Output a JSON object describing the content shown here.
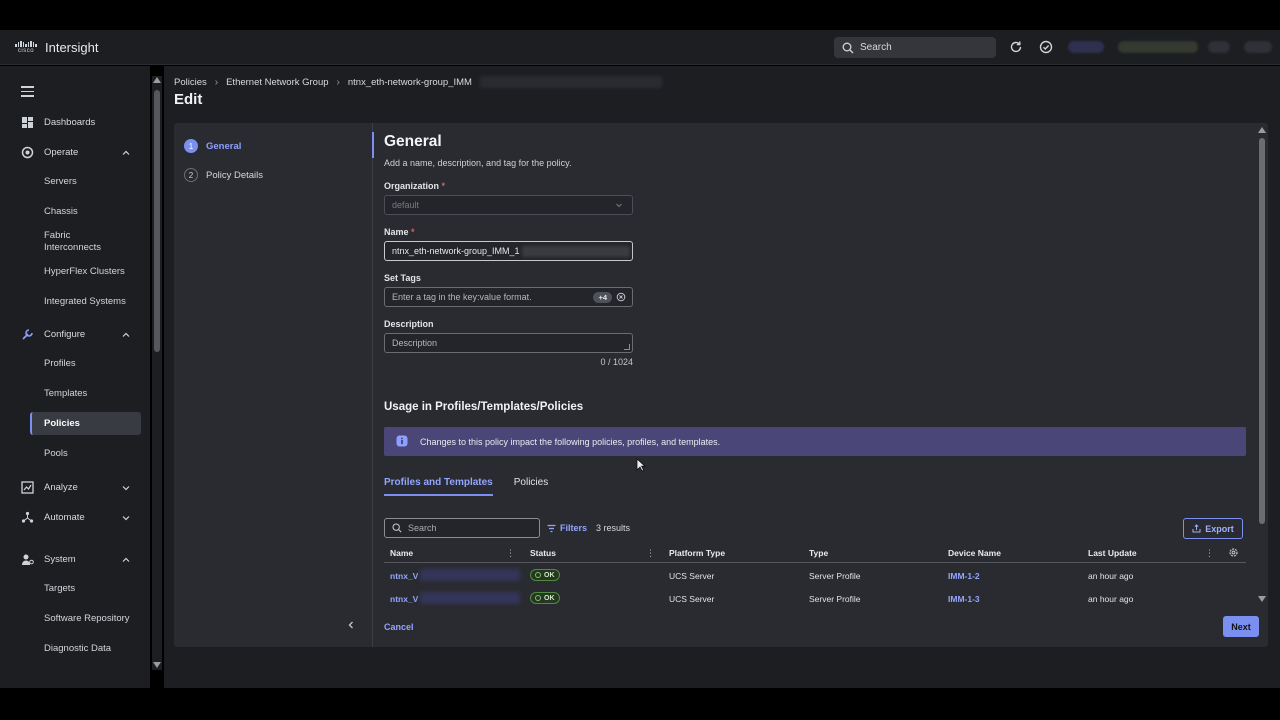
{
  "app": {
    "brand_word": "cisco",
    "name": "Intersight"
  },
  "topbar": {
    "search_label": "Search"
  },
  "sidebar": {
    "dashboards": "Dashboards",
    "operate": {
      "label": "Operate",
      "items": [
        "Servers",
        "Chassis",
        "Fabric Interconnects",
        "HyperFlex Clusters",
        "Integrated Systems"
      ]
    },
    "configure": {
      "label": "Configure",
      "items": [
        "Profiles",
        "Templates",
        "Policies",
        "Pools"
      ]
    },
    "analyze": "Analyze",
    "automate": "Automate",
    "system": {
      "label": "System",
      "items": [
        "Targets",
        "Software Repository",
        "Diagnostic Data"
      ]
    }
  },
  "breadcrumb": [
    "Policies",
    "Ethernet Network Group",
    "ntnx_eth-network-group_IMM"
  ],
  "page_title": "Edit",
  "steps": [
    {
      "num": "1",
      "label": "General"
    },
    {
      "num": "2",
      "label": "Policy Details"
    }
  ],
  "general": {
    "title": "General",
    "subtitle": "Add a name, description, and tag for the policy.",
    "organization": {
      "label": "Organization",
      "value": "default"
    },
    "name": {
      "label": "Name",
      "value": "ntnx_eth-network-group_IMM_1"
    },
    "tags": {
      "label": "Set Tags",
      "placeholder": "Enter a tag in the key:value format.",
      "badge": "+4"
    },
    "description": {
      "label": "Description",
      "placeholder": "Description",
      "counter": "0 / 1024"
    }
  },
  "usage": {
    "title": "Usage in Profiles/Templates/Policies",
    "banner": "Changes to this policy impact the following policies, profiles, and templates.",
    "tabs": [
      "Profiles and Templates",
      "Policies"
    ],
    "search_placeholder": "Search",
    "filters_label": "Filters",
    "results": "3 results",
    "export_label": "Export",
    "columns": [
      "Name",
      "Status",
      "Platform Type",
      "Type",
      "Device Name",
      "Last Update"
    ],
    "rows": [
      {
        "name": "ntnx_V",
        "status": "OK",
        "platform": "UCS Server",
        "type": "Server Profile",
        "device": "IMM-1-2",
        "updated": "an hour ago"
      },
      {
        "name": "ntnx_V",
        "status": "OK",
        "platform": "UCS Server",
        "type": "Server Profile",
        "device": "IMM-1-3",
        "updated": "an hour ago"
      }
    ]
  },
  "footer": {
    "cancel": "Cancel",
    "next": "Next"
  },
  "colors": {
    "accent": "#7b8ff0",
    "banner": "#4a4677",
    "ok": "#4e8c44"
  }
}
